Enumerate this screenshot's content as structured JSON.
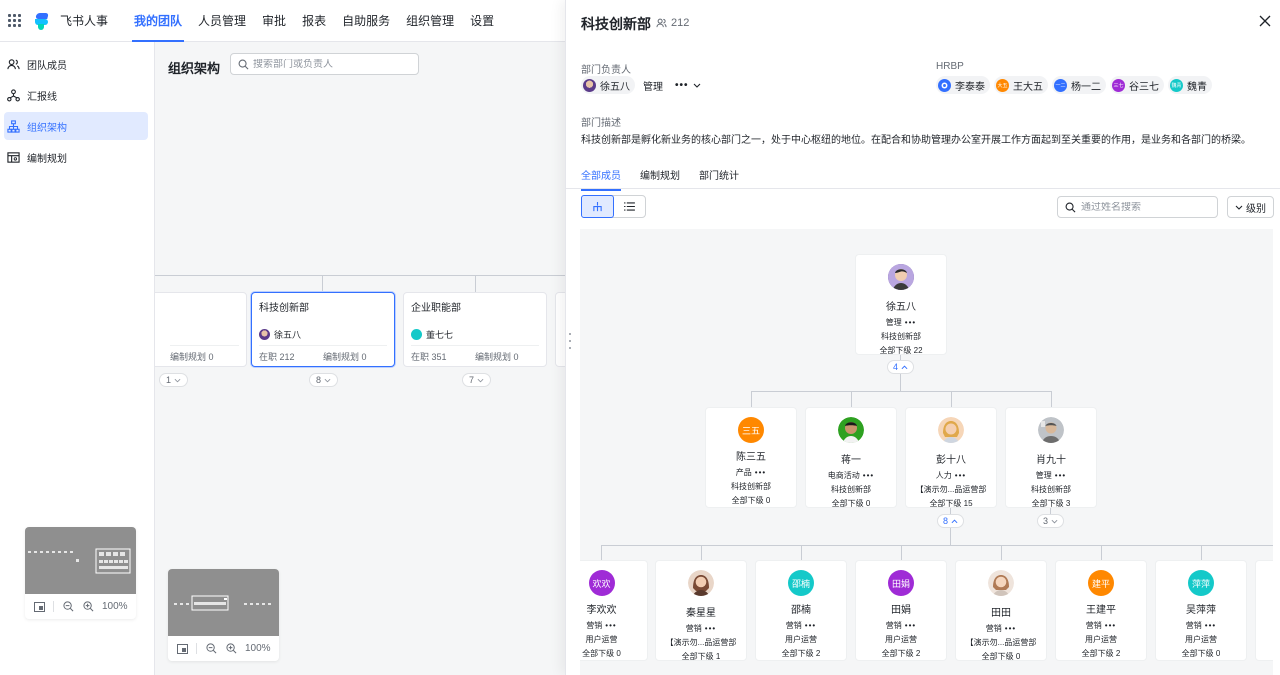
{
  "app": {
    "name": "飞书人事",
    "nav_tabs": [
      "我的团队",
      "人员管理",
      "审批",
      "报表",
      "自助服务",
      "组织管理",
      "设置"
    ],
    "active_tab": "我的团队",
    "brand_color": "#3370ff"
  },
  "sidebar": {
    "items": [
      {
        "label": "团队成员",
        "icon": "team-members-icon"
      },
      {
        "label": "汇报线",
        "icon": "report-line-icon"
      },
      {
        "label": "组织架构",
        "icon": "org-chart-icon",
        "active": true
      },
      {
        "label": "编制规划",
        "icon": "headcount-plan-icon"
      }
    ]
  },
  "main": {
    "title": "组织架构",
    "search_placeholder": "搜索部门或负责人",
    "dept_cards": [
      {
        "name": "",
        "head": "",
        "staff": "",
        "plan": "编制规划 0",
        "count": "1"
      },
      {
        "name": "科技创新部",
        "head": "徐五八",
        "staff": "在职 212",
        "plan": "编制规划 0",
        "count": "8",
        "selected": true
      },
      {
        "name": "企业职能部",
        "head": "董七七",
        "staff": "在职 351",
        "plan": "编制规划 0",
        "count": "7"
      }
    ],
    "thumbnails": [
      {
        "zoom": "100%"
      },
      {
        "zoom": "100%"
      }
    ]
  },
  "drawer": {
    "title": "科技创新部",
    "member_count": "212",
    "head_label": "部门负责人",
    "head": {
      "name": "徐五八",
      "role": "管理",
      "more": "•••"
    },
    "hrbp_label": "HRBP",
    "hrbps": [
      {
        "name": "李泰泰",
        "color": "#3370ff"
      },
      {
        "name": "王大五",
        "color": "#ff8800",
        "initials": "大五"
      },
      {
        "name": "杨一二",
        "color": "#3370ff",
        "initials": "一二"
      },
      {
        "name": "谷三七",
        "color": "#9f2bd6",
        "initials": "三七"
      },
      {
        "name": "魏青",
        "color": "#14c9c9",
        "initials": "魏青"
      }
    ],
    "desc_label": "部门描述",
    "desc": "科技创新部是孵化新业务的核心部门之一，处于中心枢纽的地位。在配合和协助管理办公室开展工作方面起到至关重要的作用，是业务和各部门的桥梁。",
    "tabs": [
      "全部成员",
      "编制规划",
      "部门统计"
    ],
    "active_tab": "全部成员",
    "search_placeholder": "通过姓名搜索",
    "level_label": "级别",
    "root": {
      "name": "徐五八",
      "role": "管理",
      "dept": "科技创新部",
      "sub": "全部下级 22",
      "expand": "4"
    },
    "level2": [
      {
        "name": "陈三五",
        "initials": "三五",
        "color": "#ff8800",
        "role": "产品",
        "dept": "科技创新部",
        "sub": "全部下级 0"
      },
      {
        "name": "蒋一",
        "color": "#2ea121",
        "photo": true,
        "role": "电商活动",
        "dept": "科技创新部",
        "sub": "全部下级 0"
      },
      {
        "name": "彭十八",
        "color": "#f5a623",
        "photo": true,
        "role": "人力",
        "dept": "【演示勿...品运营部",
        "sub": "全部下级 15",
        "expand": "8"
      },
      {
        "name": "肖九十",
        "color": "#8f959e",
        "photo": true,
        "role": "管理",
        "dept": "科技创新部",
        "sub": "全部下级 3",
        "expand": "3"
      }
    ],
    "level3": [
      {
        "name": "李欢欢",
        "initials": "欢欢",
        "color": "#9f2bd6",
        "role": "营销",
        "dept": "用户运营",
        "sub": "全部下级 0"
      },
      {
        "name": "秦星星",
        "color": "#c87a5a",
        "photo": true,
        "role": "营销",
        "dept": "【演示勿...品运营部",
        "sub": "全部下级 1"
      },
      {
        "name": "邵楠",
        "initials": "邵楠",
        "color": "#14c9c9",
        "role": "营销",
        "dept": "用户运营",
        "sub": "全部下级 2"
      },
      {
        "name": "田娟",
        "initials": "田娟",
        "color": "#9f2bd6",
        "role": "营销",
        "dept": "用户运营",
        "sub": "全部下级 2"
      },
      {
        "name": "田田",
        "color": "#d9a58a",
        "photo": true,
        "role": "营销",
        "dept": "【演示勿...品运营部",
        "sub": "全部下级 0"
      },
      {
        "name": "王建平",
        "initials": "建平",
        "color": "#ff8800",
        "role": "营销",
        "dept": "用户运营",
        "sub": "全部下级 2"
      },
      {
        "name": "吴萍萍",
        "initials": "萍萍",
        "color": "#14c9c9",
        "role": "营销",
        "dept": "用户运营",
        "sub": "全部下级 0"
      }
    ],
    "more_dots": "•••"
  }
}
